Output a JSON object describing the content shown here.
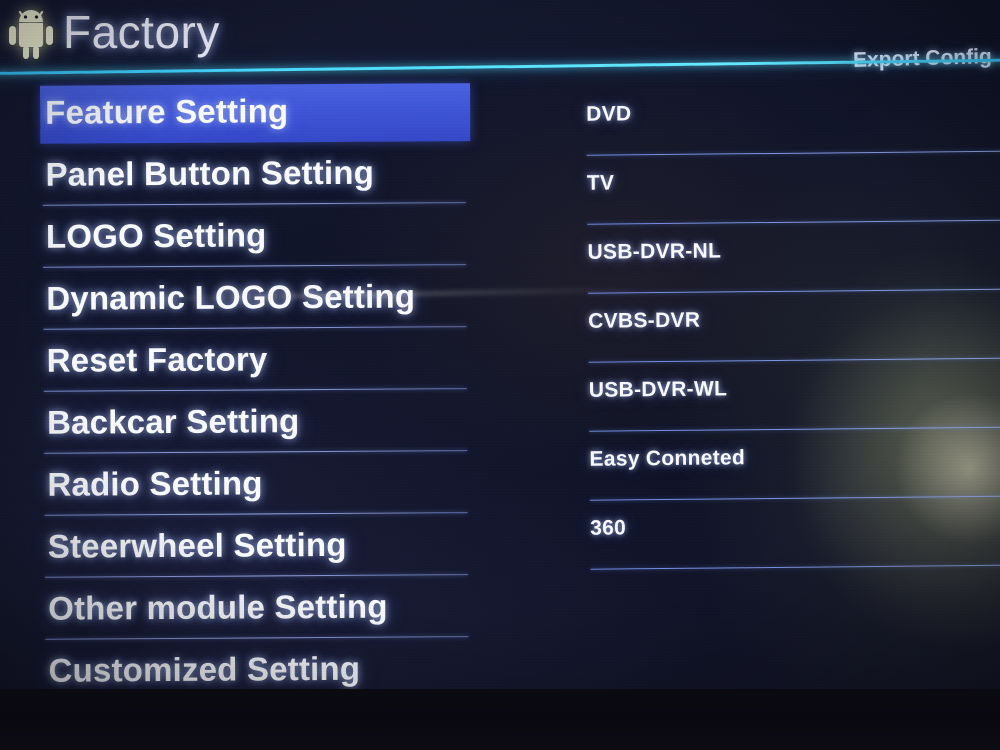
{
  "header": {
    "app_icon": "android-robot-icon",
    "title": "Factory",
    "export_label": "Export Config",
    "rule_color": "#4fe2ff"
  },
  "sidebar": {
    "selected_index": 0,
    "highlight_color": "#3d53d6",
    "items": [
      {
        "label": "Feature Setting"
      },
      {
        "label": "Panel Button Setting"
      },
      {
        "label": "LOGO Setting"
      },
      {
        "label": "Dynamic LOGO Setting"
      },
      {
        "label": "Reset Factory"
      },
      {
        "label": "Backcar Setting"
      },
      {
        "label": "Radio Setting"
      },
      {
        "label": "Steerwheel Setting"
      },
      {
        "label": "Other module Setting"
      },
      {
        "label": "Customized Setting"
      }
    ]
  },
  "options_panel": {
    "items": [
      {
        "label": "DVD"
      },
      {
        "label": "TV"
      },
      {
        "label": "USB-DVR-NL"
      },
      {
        "label": "CVBS-DVR"
      },
      {
        "label": "USB-DVR-WL"
      },
      {
        "label": "Easy Conneted"
      },
      {
        "label": "360"
      }
    ]
  },
  "theme": {
    "background": "#11152a",
    "text_color": "#fbfcff",
    "divider_color": "#9ab0ff"
  }
}
